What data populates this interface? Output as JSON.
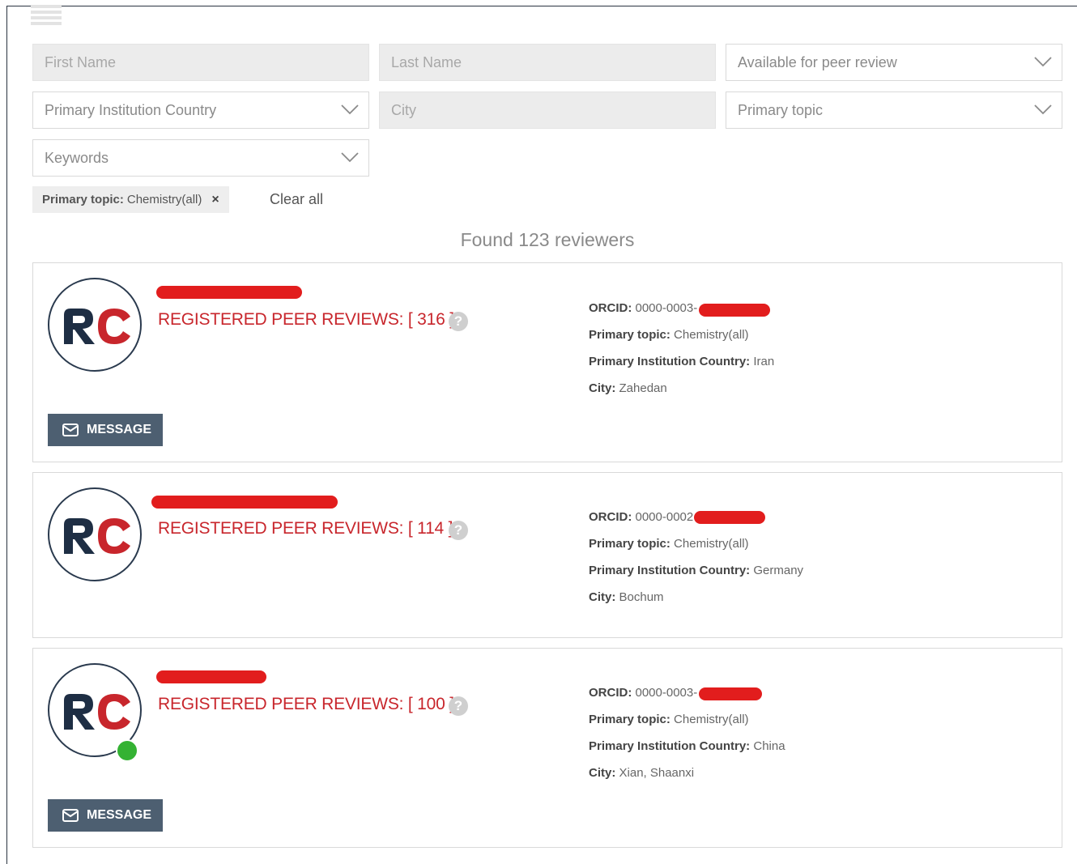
{
  "filters": {
    "first_name_placeholder": "First Name",
    "last_name_placeholder": "Last Name",
    "available_placeholder": "Available for peer review",
    "country_placeholder": "Primary Institution Country",
    "city_placeholder": "City",
    "topic_placeholder": "Primary topic",
    "keywords_placeholder": "Keywords"
  },
  "active_filter": {
    "label": "Primary topic:",
    "value": "Chemistry(all)",
    "remove_glyph": "×"
  },
  "clear_all_label": "Clear all",
  "results_text": "Found 123 reviewers",
  "colors": {
    "accent_red": "#c8262c",
    "button_bg": "#4d5f71",
    "online_green": "#34b233",
    "redaction": "#e21d1d"
  },
  "labels": {
    "orcid": "ORCID:",
    "topic": "Primary topic:",
    "country": "Primary Institution Country:",
    "city": "City:",
    "message_button": "MESSAGE",
    "help_glyph": "?"
  },
  "reviewers": [
    {
      "reviews_text": "REGISTERED PEER REVIEWS: [ 316 ]",
      "orcid": "0000-0003-",
      "topic": "Chemistry(all)",
      "country": "Iran",
      "city": "Zahedan",
      "online": false,
      "has_message_button": true
    },
    {
      "reviews_text": "REGISTERED PEER REVIEWS: [ 114 ]",
      "orcid": "0000-0002",
      "topic": "Chemistry(all)",
      "country": "Germany",
      "city": "Bochum",
      "online": false,
      "has_message_button": false
    },
    {
      "reviews_text": "REGISTERED PEER REVIEWS: [ 100 ]",
      "orcid": "0000-0003-",
      "topic": "Chemistry(all)",
      "country": "China",
      "city": "Xian, Shaanxi",
      "online": true,
      "has_message_button": true
    }
  ]
}
